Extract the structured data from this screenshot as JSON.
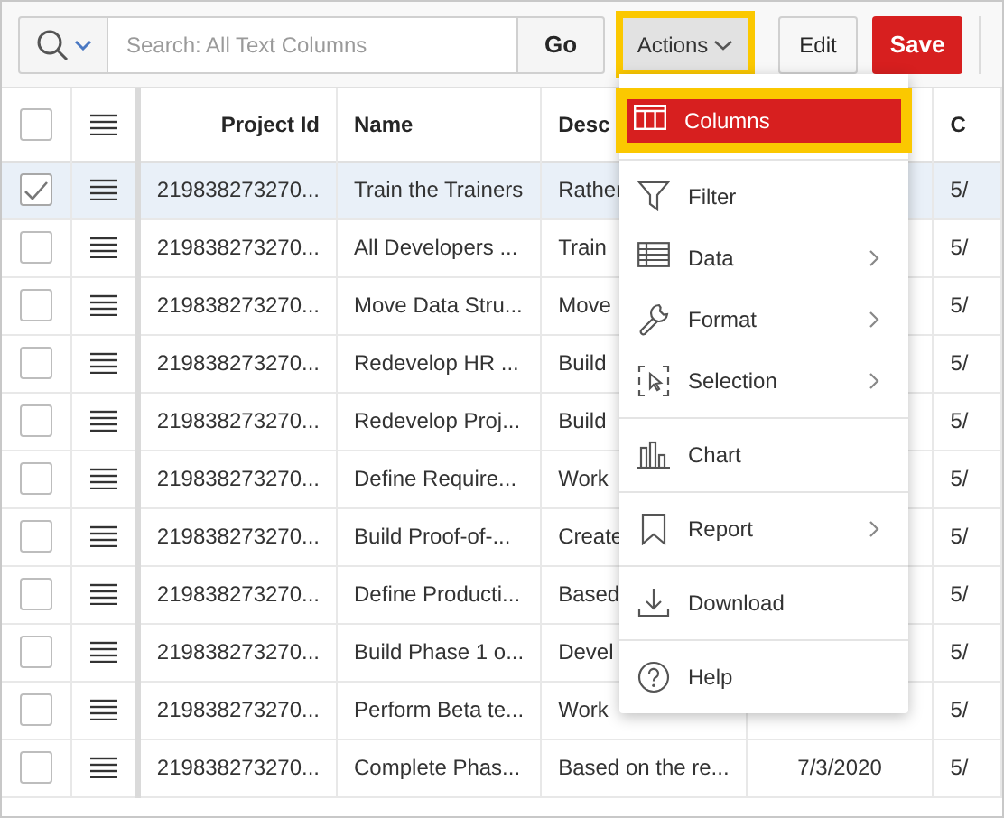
{
  "toolbar": {
    "search": {
      "placeholder": "Search: All Text Columns"
    },
    "go_button": "Go",
    "actions_button": {
      "label": "Actions",
      "annotated": true
    },
    "edit_button": "Edit",
    "save_button": "Save"
  },
  "table": {
    "select_all": {
      "checked": false
    },
    "columns": [
      {
        "label": "Project Id"
      },
      {
        "label": "Name"
      },
      {
        "label": "Desc"
      },
      {},
      {
        "label": "C"
      }
    ],
    "rows": [
      {
        "selected": true,
        "cells": [
          "219838273270...",
          "Train the Trainers",
          "Rather",
          null,
          "5/"
        ]
      },
      {
        "selected": false,
        "cells": [
          "219838273270...",
          "All Developers ...",
          "Train",
          null,
          "5/"
        ]
      },
      {
        "selected": false,
        "cells": [
          "219838273270...",
          "Move Data Stru...",
          "Move",
          null,
          "5/"
        ]
      },
      {
        "selected": false,
        "cells": [
          "219838273270...",
          "Redevelop HR ...",
          "Build",
          null,
          "5/"
        ]
      },
      {
        "selected": false,
        "cells": [
          "219838273270...",
          "Redevelop Proj...",
          "Build",
          null,
          "5/"
        ]
      },
      {
        "selected": false,
        "cells": [
          "219838273270...",
          "Define Require...",
          "Work",
          null,
          "5/"
        ]
      },
      {
        "selected": false,
        "cells": [
          "219838273270...",
          "Build Proof-of-...",
          "Create",
          null,
          "5/"
        ]
      },
      {
        "selected": false,
        "cells": [
          "219838273270...",
          "Define Producti...",
          "Based",
          null,
          "5/"
        ]
      },
      {
        "selected": false,
        "cells": [
          "219838273270...",
          "Build Phase 1 o...",
          "Devel",
          null,
          "5/"
        ]
      },
      {
        "selected": false,
        "cells": [
          "219838273270...",
          "Perform Beta te...",
          "Work",
          null,
          "5/"
        ]
      },
      {
        "selected": false,
        "cells": [
          "219838273270...",
          "Complete Phas...",
          "Based on the re...",
          "7/3/2020",
          "5/"
        ]
      }
    ]
  },
  "menu": {
    "groups": [
      [
        {
          "kind": "columns",
          "label": "Columns",
          "selected": true,
          "annotated": true,
          "submenu": false
        }
      ],
      [
        {
          "kind": "filter",
          "label": "Filter",
          "selected": false,
          "annotated": false,
          "submenu": false
        },
        {
          "kind": "data",
          "label": "Data",
          "selected": false,
          "annotated": false,
          "submenu": true
        },
        {
          "kind": "format",
          "label": "Format",
          "selected": false,
          "annotated": false,
          "submenu": true
        },
        {
          "kind": "selection",
          "label": "Selection",
          "selected": false,
          "annotated": false,
          "submenu": true
        }
      ],
      [
        {
          "kind": "chart",
          "label": "Chart",
          "selected": false,
          "annotated": false,
          "submenu": false
        }
      ],
      [
        {
          "kind": "report",
          "label": "Report",
          "selected": false,
          "annotated": false,
          "submenu": true
        }
      ],
      [
        {
          "kind": "download",
          "label": "Download",
          "selected": false,
          "annotated": false,
          "submenu": false
        }
      ],
      [
        {
          "kind": "help",
          "label": "Help",
          "selected": false,
          "annotated": false,
          "submenu": false
        }
      ]
    ]
  }
}
